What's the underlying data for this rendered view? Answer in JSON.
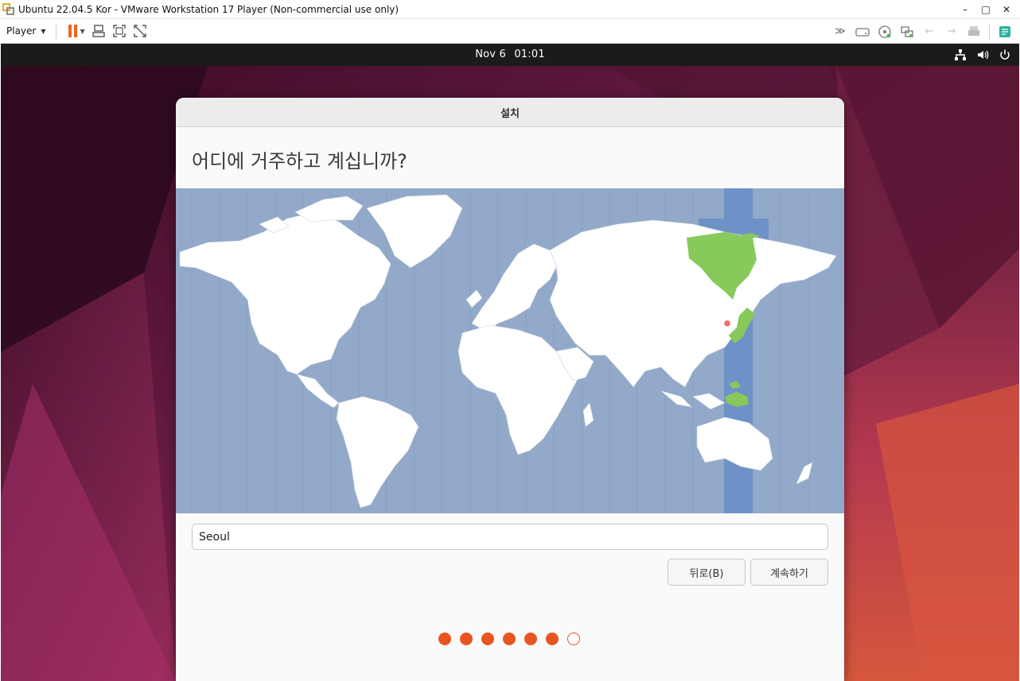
{
  "window": {
    "title": "Ubuntu 22.04.5 Kor - VMware Workstation 17 Player (Non-commercial use only)",
    "minimize": "–",
    "maximize": "□",
    "close": "✕"
  },
  "toolbar": {
    "player_label": "Player"
  },
  "gnome": {
    "date": "Nov 6",
    "time": "01:01"
  },
  "installer": {
    "title": "설치",
    "question": "어디에 거주하고 계십니까?",
    "timezone_value": "Seoul",
    "back_label": "뒤로(B)",
    "continue_label": "계속하기",
    "steps_total": 7,
    "steps_completed": 6
  },
  "map": {
    "selected_city": "Seoul",
    "highlight_color": "#87c95a",
    "ocean_color": "#93a9c9",
    "band_color": "#6e92c7"
  },
  "colors": {
    "accent": "#e95420",
    "pause": "#f0641e"
  }
}
